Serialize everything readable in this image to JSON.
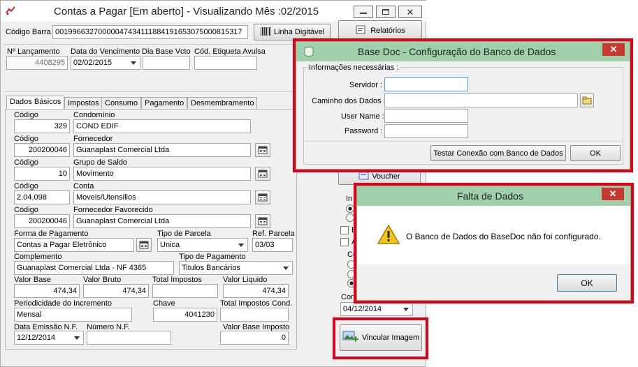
{
  "main": {
    "title": "Contas a Pagar [Em aberto] - Visualizando Mês :02/2015",
    "barcode_label": "Código Barra",
    "barcode_value": "00199663270000047434111884191653075000815317",
    "linha_digitavel_label": "Linha Digitável",
    "relatorios_label": "Relatórios",
    "header_labels": {
      "lancamento": "Nº Lançamento",
      "vencimento": "Data do Vencimento",
      "dia_base": "Dia Base Vcto",
      "etiqueta": "Cód. Etiqueta Avulsa"
    },
    "lancamento_value": "4408295",
    "vencimento_value": "02/02/2015",
    "tabs": [
      "Dados Básicos",
      "Impostos",
      "Consumo",
      "Pagamento",
      "Desmembramento"
    ],
    "fields": {
      "codigo_label": "Código",
      "condominio_label": "Condomínio",
      "condominio_code": "329",
      "condominio_name": "COND EDIF",
      "fornecedor_label": "Fornecedor",
      "fornecedor_code": "200200046",
      "fornecedor_name": "Guanaplast Comercial Ltda",
      "grupo_label": "Grupo de Saldo",
      "grupo_code": "10",
      "grupo_name": "Movimento",
      "conta_label": "Conta",
      "conta_code": "2.04.098",
      "conta_name": "Moveis/Utensilios",
      "favorecido_label": "Fornecedor Favorecido",
      "favorecido_code": "200200046",
      "favorecido_name": "Guanaplast Comercial Ltda",
      "forma_pgto_label": "Forma de Pagamento",
      "forma_pgto_value": "Contas a Pagar Eletrônico",
      "tipo_parcela_label": "Tipo de Parcela",
      "tipo_parcela_value": "Unica",
      "ref_parcela_label": "Ref. Parcela",
      "ref_parcela_value": "03/03",
      "complemento_label": "Complemento",
      "complemento_value": "Guanaplast Comercial Ltda - NF 4365",
      "tipo_pgto_label": "Tipo de Pagamento",
      "tipo_pgto_value": "Titulos Bancários",
      "valor_base_label": "Valor Base",
      "valor_base_value": "474,34",
      "valor_bruto_label": "Valor Bruto",
      "valor_bruto_value": "474,34",
      "total_impostos_label": "Total Impostos",
      "valor_liquido_label": "Valor Liquido",
      "valor_liquido_value": "474,34",
      "periodicidade_label": "Periodicidade do Incremento",
      "periodicidade_value": "Mensal",
      "chave_label": "Chave",
      "chave_value": "4041230",
      "total_impostos_cond_label": "Total Impostos Cond.",
      "data_emissao_label": "Data Emissão N.F.",
      "data_emissao_value": "12/12/2014",
      "numero_nf_label": "Número N.F.",
      "valor_base_imposto_label": "Valor Base Imposto",
      "valor_base_imposto_value": "0"
    },
    "side": {
      "voucher_label": "Voucher",
      "partial_in": "In",
      "partial_e": "E",
      "partial_a": "A",
      "partial_co": "Co",
      "partial_con": "Con",
      "date_value": "04/12/2014",
      "vincular_label": "Vincular Imagem"
    }
  },
  "config_dialog": {
    "title": "Base Doc - Configuração do Banco de Dados",
    "group_label": "Informações necessárias :",
    "servidor_label": "Servidor :",
    "caminho_label": "Caminho dos Dados :",
    "username_label": "User Name :",
    "password_label": "Password :",
    "test_button": "Testar Conexão com Banco de Dados",
    "ok_button": "OK"
  },
  "alert_dialog": {
    "title": "Falta de Dados",
    "message": "O Banco de Dados do BaseDoc não foi configurado.",
    "ok_button": "OK"
  },
  "colors": {
    "dialog_title_bg": "#9fd0a9",
    "highlight_red": "#e0001a",
    "close_red": "#c83a30"
  }
}
